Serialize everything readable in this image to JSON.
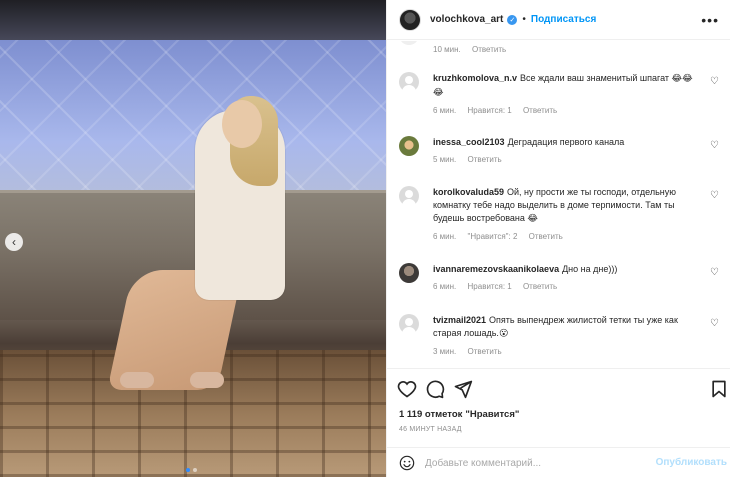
{
  "header": {
    "username": "volochkova_art",
    "separator": "•",
    "follow_label": "Подписаться",
    "more_label": "•••"
  },
  "top_comment_meta": {
    "time": "10 мин.",
    "reply": "Ответить"
  },
  "comments": [
    {
      "user": "kruzhkomolova_n.v",
      "text": "Все ждали ваш знаменитый шпагат",
      "emoji": "😂😂😂",
      "time": "6 мин.",
      "likes": "Нравится: 1",
      "reply": "Ответить"
    },
    {
      "user": "inessa_cool2103",
      "text": "Деградация первого канала",
      "emoji": "",
      "time": "5 мин.",
      "likes": "",
      "reply": "Ответить"
    },
    {
      "user": "korolkovaluda59",
      "text": "Ой, ну прости же ты господи, отдельную комнатку тебе надо выделить в доме терпимости. Там ты будешь востребована",
      "emoji": "😂",
      "time": "6 мин.",
      "likes": "\"Нравится\": 2",
      "reply": "Ответить"
    },
    {
      "user": "ivannaremezovskaanikolaeva",
      "text": "Дно на дне)))",
      "emoji": "",
      "time": "6 мин.",
      "likes": "Нравится: 1",
      "reply": "Ответить"
    },
    {
      "user": "tvizmail2021",
      "text": "Опять выпендреж жилистой тетки ты уже как старая лошадь.",
      "emoji": "😮",
      "time": "3 мин.",
      "likes": "",
      "reply": "Ответить"
    }
  ],
  "likes": {
    "count": "1 119 отметок",
    "label": "\"Нравится\""
  },
  "post_time": "46 МИНУТ НАЗАД",
  "add_comment": {
    "placeholder": "Добавьте комментарий...",
    "publish_label": "Опубликовать"
  },
  "colors": {
    "accent": "#0095f6",
    "muted": "#8e8e8e",
    "publish_disabled": "#b2dffc"
  },
  "icons": [
    "chevron-left-icon",
    "heart-icon",
    "comment-icon",
    "share-icon",
    "bookmark-icon",
    "smile-icon",
    "verified-icon",
    "more-icon"
  ]
}
